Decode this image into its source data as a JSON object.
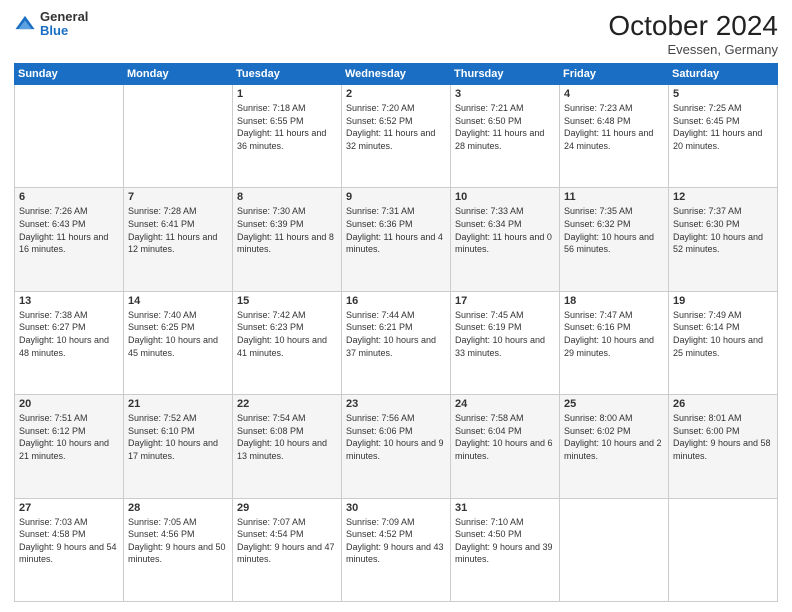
{
  "logo": {
    "general": "General",
    "blue": "Blue"
  },
  "header": {
    "month": "October 2024",
    "location": "Evessen, Germany"
  },
  "weekdays": [
    "Sunday",
    "Monday",
    "Tuesday",
    "Wednesday",
    "Thursday",
    "Friday",
    "Saturday"
  ],
  "weeks": [
    [
      {
        "day": "",
        "sunrise": "",
        "sunset": "",
        "daylight": ""
      },
      {
        "day": "",
        "sunrise": "",
        "sunset": "",
        "daylight": ""
      },
      {
        "day": "1",
        "sunrise": "Sunrise: 7:18 AM",
        "sunset": "Sunset: 6:55 PM",
        "daylight": "Daylight: 11 hours and 36 minutes."
      },
      {
        "day": "2",
        "sunrise": "Sunrise: 7:20 AM",
        "sunset": "Sunset: 6:52 PM",
        "daylight": "Daylight: 11 hours and 32 minutes."
      },
      {
        "day": "3",
        "sunrise": "Sunrise: 7:21 AM",
        "sunset": "Sunset: 6:50 PM",
        "daylight": "Daylight: 11 hours and 28 minutes."
      },
      {
        "day": "4",
        "sunrise": "Sunrise: 7:23 AM",
        "sunset": "Sunset: 6:48 PM",
        "daylight": "Daylight: 11 hours and 24 minutes."
      },
      {
        "day": "5",
        "sunrise": "Sunrise: 7:25 AM",
        "sunset": "Sunset: 6:45 PM",
        "daylight": "Daylight: 11 hours and 20 minutes."
      }
    ],
    [
      {
        "day": "6",
        "sunrise": "Sunrise: 7:26 AM",
        "sunset": "Sunset: 6:43 PM",
        "daylight": "Daylight: 11 hours and 16 minutes."
      },
      {
        "day": "7",
        "sunrise": "Sunrise: 7:28 AM",
        "sunset": "Sunset: 6:41 PM",
        "daylight": "Daylight: 11 hours and 12 minutes."
      },
      {
        "day": "8",
        "sunrise": "Sunrise: 7:30 AM",
        "sunset": "Sunset: 6:39 PM",
        "daylight": "Daylight: 11 hours and 8 minutes."
      },
      {
        "day": "9",
        "sunrise": "Sunrise: 7:31 AM",
        "sunset": "Sunset: 6:36 PM",
        "daylight": "Daylight: 11 hours and 4 minutes."
      },
      {
        "day": "10",
        "sunrise": "Sunrise: 7:33 AM",
        "sunset": "Sunset: 6:34 PM",
        "daylight": "Daylight: 11 hours and 0 minutes."
      },
      {
        "day": "11",
        "sunrise": "Sunrise: 7:35 AM",
        "sunset": "Sunset: 6:32 PM",
        "daylight": "Daylight: 10 hours and 56 minutes."
      },
      {
        "day": "12",
        "sunrise": "Sunrise: 7:37 AM",
        "sunset": "Sunset: 6:30 PM",
        "daylight": "Daylight: 10 hours and 52 minutes."
      }
    ],
    [
      {
        "day": "13",
        "sunrise": "Sunrise: 7:38 AM",
        "sunset": "Sunset: 6:27 PM",
        "daylight": "Daylight: 10 hours and 48 minutes."
      },
      {
        "day": "14",
        "sunrise": "Sunrise: 7:40 AM",
        "sunset": "Sunset: 6:25 PM",
        "daylight": "Daylight: 10 hours and 45 minutes."
      },
      {
        "day": "15",
        "sunrise": "Sunrise: 7:42 AM",
        "sunset": "Sunset: 6:23 PM",
        "daylight": "Daylight: 10 hours and 41 minutes."
      },
      {
        "day": "16",
        "sunrise": "Sunrise: 7:44 AM",
        "sunset": "Sunset: 6:21 PM",
        "daylight": "Daylight: 10 hours and 37 minutes."
      },
      {
        "day": "17",
        "sunrise": "Sunrise: 7:45 AM",
        "sunset": "Sunset: 6:19 PM",
        "daylight": "Daylight: 10 hours and 33 minutes."
      },
      {
        "day": "18",
        "sunrise": "Sunrise: 7:47 AM",
        "sunset": "Sunset: 6:16 PM",
        "daylight": "Daylight: 10 hours and 29 minutes."
      },
      {
        "day": "19",
        "sunrise": "Sunrise: 7:49 AM",
        "sunset": "Sunset: 6:14 PM",
        "daylight": "Daylight: 10 hours and 25 minutes."
      }
    ],
    [
      {
        "day": "20",
        "sunrise": "Sunrise: 7:51 AM",
        "sunset": "Sunset: 6:12 PM",
        "daylight": "Daylight: 10 hours and 21 minutes."
      },
      {
        "day": "21",
        "sunrise": "Sunrise: 7:52 AM",
        "sunset": "Sunset: 6:10 PM",
        "daylight": "Daylight: 10 hours and 17 minutes."
      },
      {
        "day": "22",
        "sunrise": "Sunrise: 7:54 AM",
        "sunset": "Sunset: 6:08 PM",
        "daylight": "Daylight: 10 hours and 13 minutes."
      },
      {
        "day": "23",
        "sunrise": "Sunrise: 7:56 AM",
        "sunset": "Sunset: 6:06 PM",
        "daylight": "Daylight: 10 hours and 9 minutes."
      },
      {
        "day": "24",
        "sunrise": "Sunrise: 7:58 AM",
        "sunset": "Sunset: 6:04 PM",
        "daylight": "Daylight: 10 hours and 6 minutes."
      },
      {
        "day": "25",
        "sunrise": "Sunrise: 8:00 AM",
        "sunset": "Sunset: 6:02 PM",
        "daylight": "Daylight: 10 hours and 2 minutes."
      },
      {
        "day": "26",
        "sunrise": "Sunrise: 8:01 AM",
        "sunset": "Sunset: 6:00 PM",
        "daylight": "Daylight: 9 hours and 58 minutes."
      }
    ],
    [
      {
        "day": "27",
        "sunrise": "Sunrise: 7:03 AM",
        "sunset": "Sunset: 4:58 PM",
        "daylight": "Daylight: 9 hours and 54 minutes."
      },
      {
        "day": "28",
        "sunrise": "Sunrise: 7:05 AM",
        "sunset": "Sunset: 4:56 PM",
        "daylight": "Daylight: 9 hours and 50 minutes."
      },
      {
        "day": "29",
        "sunrise": "Sunrise: 7:07 AM",
        "sunset": "Sunset: 4:54 PM",
        "daylight": "Daylight: 9 hours and 47 minutes."
      },
      {
        "day": "30",
        "sunrise": "Sunrise: 7:09 AM",
        "sunset": "Sunset: 4:52 PM",
        "daylight": "Daylight: 9 hours and 43 minutes."
      },
      {
        "day": "31",
        "sunrise": "Sunrise: 7:10 AM",
        "sunset": "Sunset: 4:50 PM",
        "daylight": "Daylight: 9 hours and 39 minutes."
      },
      {
        "day": "",
        "sunrise": "",
        "sunset": "",
        "daylight": ""
      },
      {
        "day": "",
        "sunrise": "",
        "sunset": "",
        "daylight": ""
      }
    ]
  ]
}
